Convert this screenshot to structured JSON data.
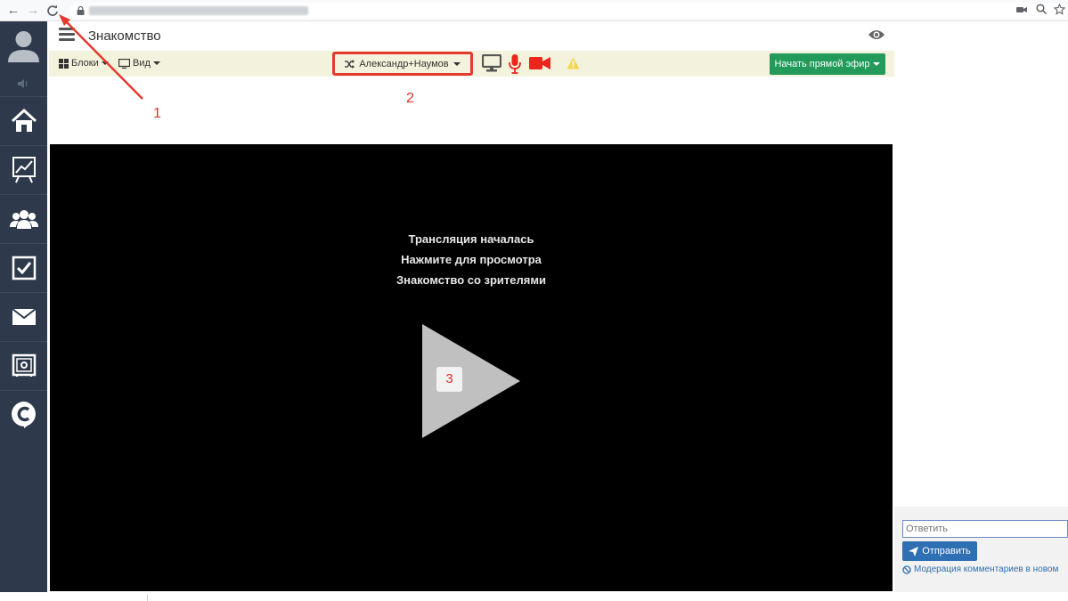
{
  "browser": {
    "nav": {
      "back": "←",
      "forward": "→",
      "reload": "C"
    }
  },
  "header": {
    "title": "Знакомство"
  },
  "toolbar": {
    "blocks_label": "Блоки",
    "view_label": "Вид",
    "speaker_label": "Александр+Наумов",
    "live_label": "Начать прямой эфир"
  },
  "player": {
    "line1": "Трансляция началась",
    "line2": "Нажмите для просмотра",
    "line3": "Знакомство со зрителями"
  },
  "annotations": {
    "n1": "1",
    "n2": "2",
    "n3": "3"
  },
  "comments": {
    "reply_placeholder": "Ответить",
    "send_label": "Отправить",
    "moderation_label": "Модерация комментариев в новом"
  },
  "colors": {
    "sidebar_bg": "#2e3a4b",
    "toolbar_bg": "#f3f2dc",
    "live_button": "#229a5a",
    "annotation_red": "#d9322a",
    "send_button": "#2f6fb3"
  },
  "icons": {
    "sidebar": [
      "user-avatar-icon",
      "volume-icon",
      "home-icon",
      "chart-board-icon",
      "users-group-icon",
      "checkbox-icon",
      "mail-icon",
      "safe-icon",
      "c-logo-icon"
    ],
    "toolbar": [
      "grid-icon",
      "monitor-icon",
      "shuffle-icon",
      "screen-share-icon",
      "microphone-icon",
      "video-camera-icon",
      "warning-icon"
    ],
    "header": [
      "hamburger-icon",
      "eye-icon"
    ]
  }
}
